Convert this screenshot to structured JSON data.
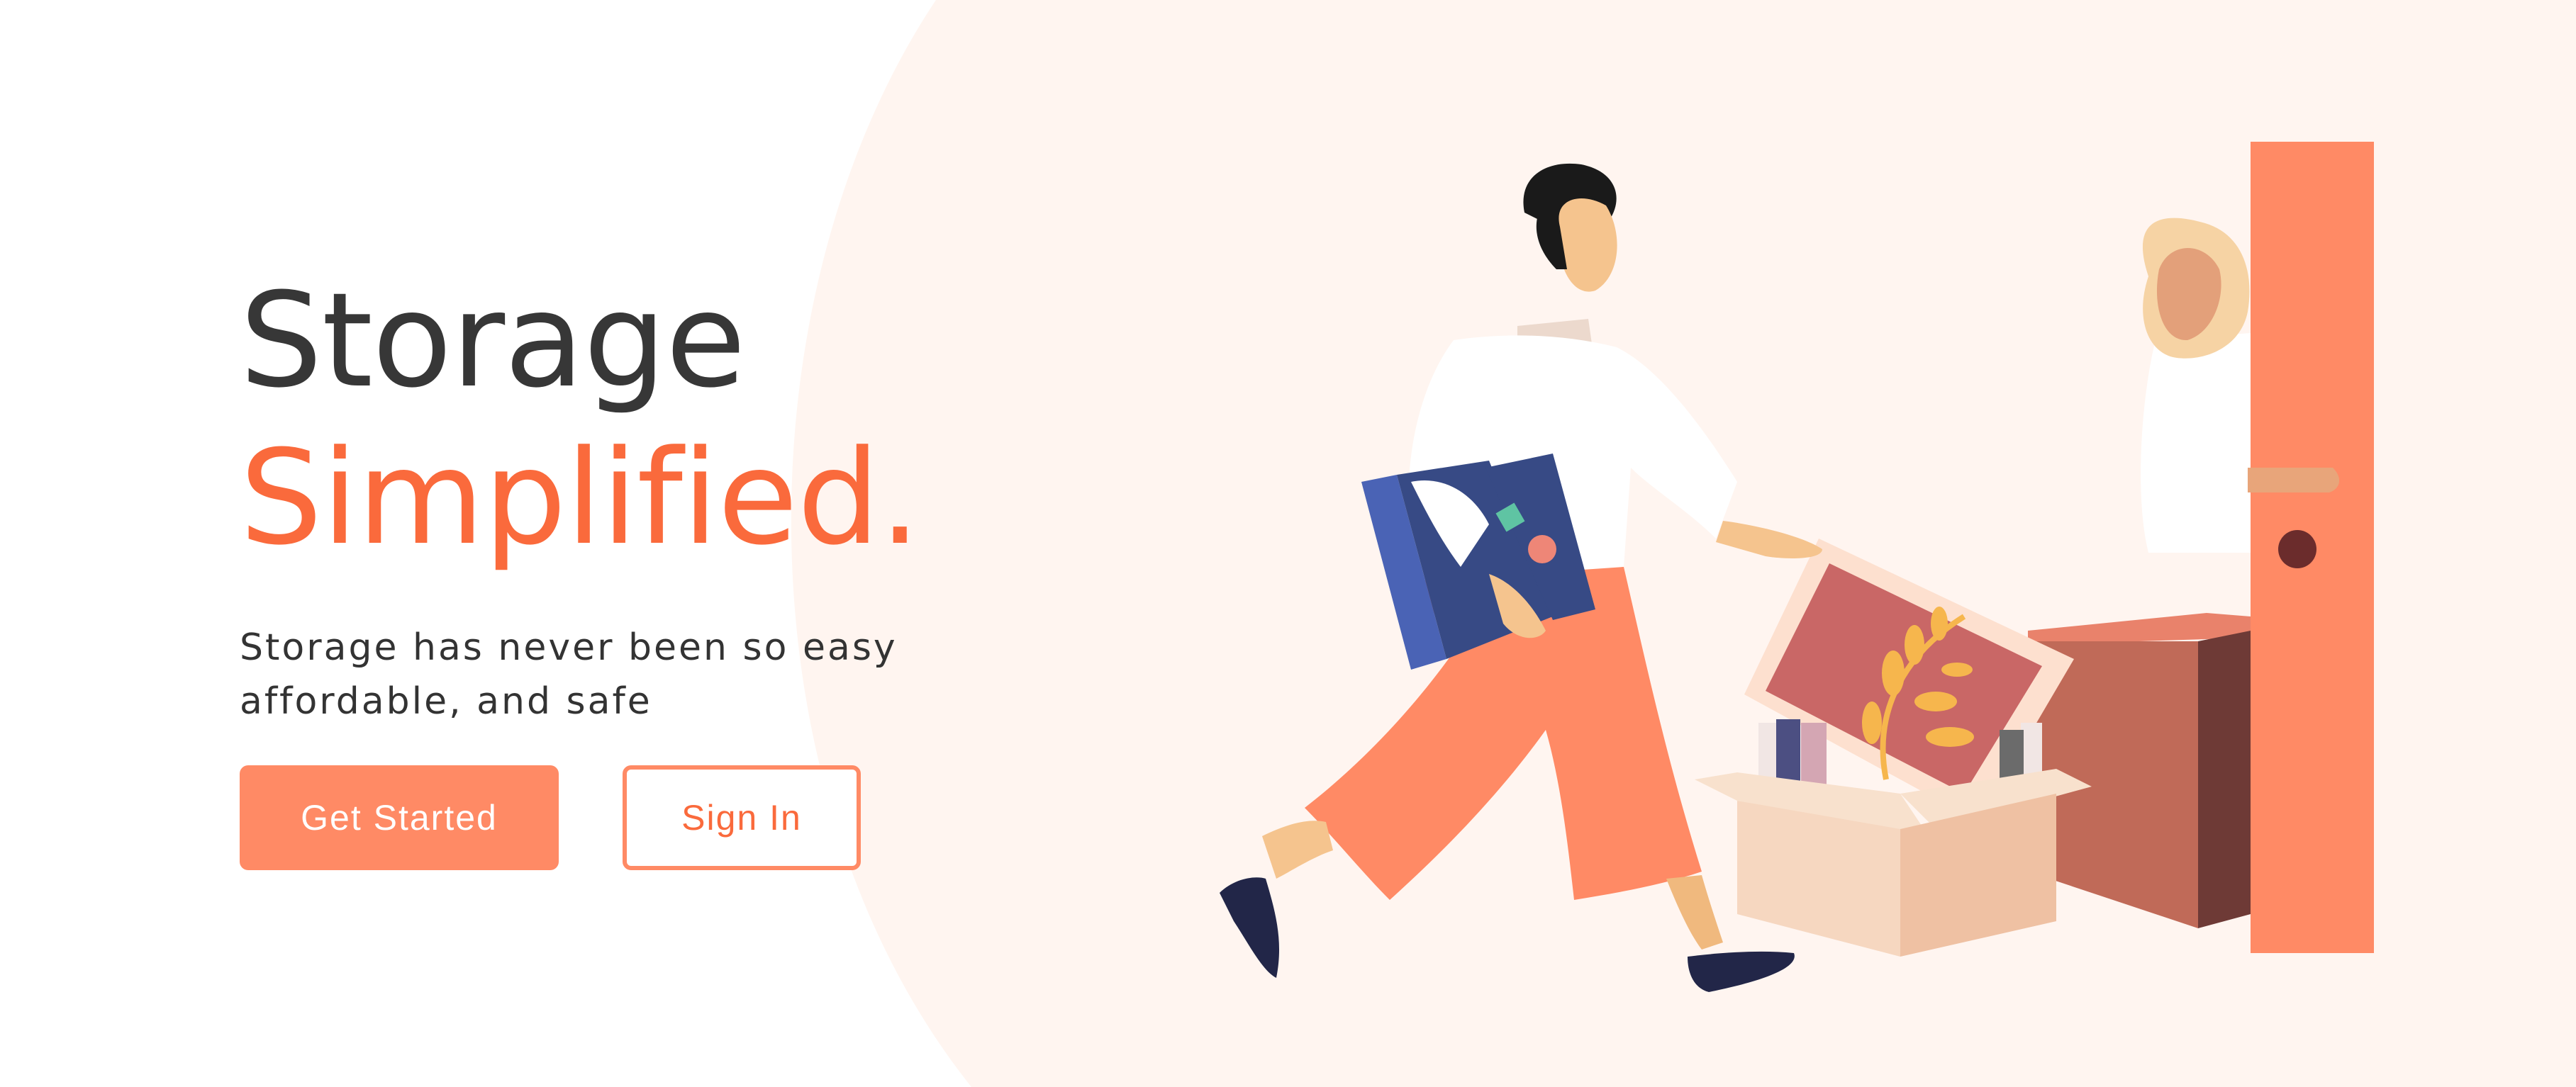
{
  "hero": {
    "headline_line1": "Storage",
    "headline_line2": "Simplified.",
    "subtitle_line1": "Storage has never been so easy",
    "subtitle_line2": "affordable, and safe"
  },
  "actions": {
    "primary_label": "Get Started",
    "secondary_label": "Sign In"
  },
  "theme": {
    "accent": "#fa6a3c",
    "button_fill": "#ff8a65",
    "background_blob": "#fff5f0",
    "text_dark": "#373737"
  }
}
